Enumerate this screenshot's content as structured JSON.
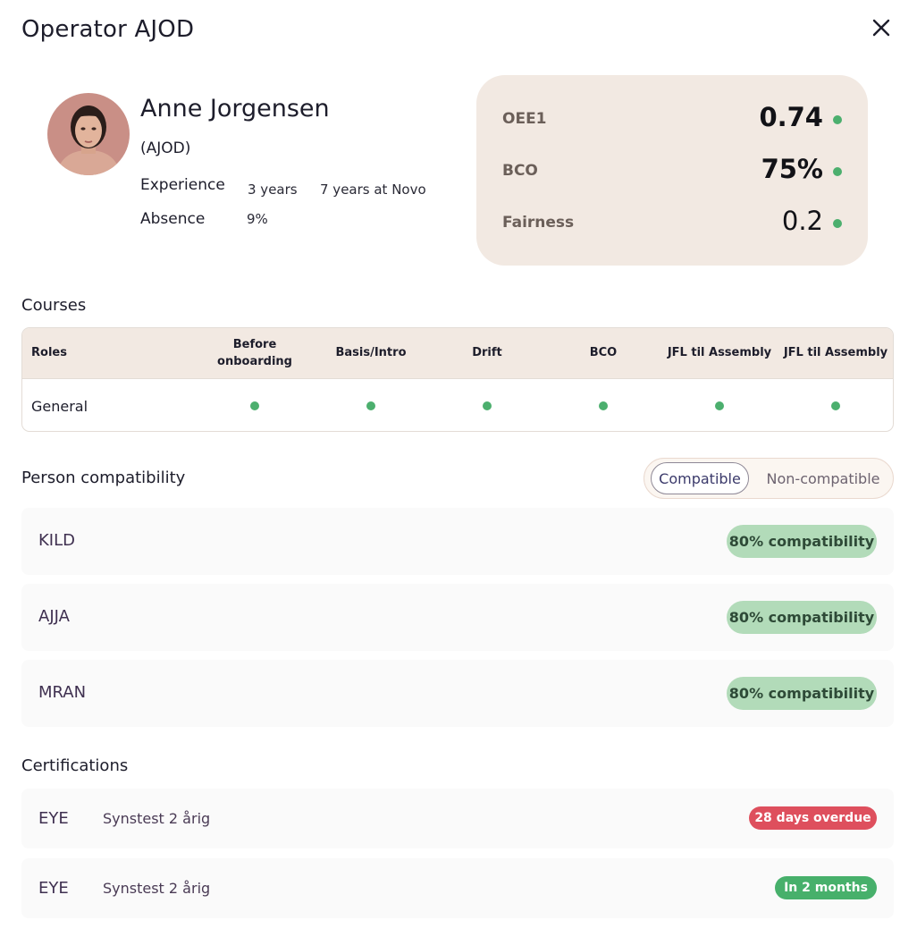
{
  "header": {
    "title": "Operator AJOD"
  },
  "profile": {
    "name": "Anne Jorgensen",
    "code": "(AJOD)",
    "experience_label": "Experience",
    "experience_value": "3 years",
    "experience_company": "7 years at Novo",
    "absence_label": "Absence",
    "absence_value": "9%"
  },
  "kpis": [
    {
      "label": "OEE1",
      "value": "0.74",
      "status_color": "#4caf6e"
    },
    {
      "label": "BCO",
      "value": "75%",
      "status_color": "#4caf6e"
    },
    {
      "label": "Fairness",
      "value": "0.2",
      "status_color": "#4caf6e"
    }
  ],
  "courses": {
    "section_title": "Courses",
    "columns": [
      "Roles",
      "Before onboarding",
      "Basis/Intro",
      "Drift",
      "BCO",
      "JFL til Assembly",
      "JFL til Assembly"
    ],
    "rows": [
      {
        "role": "General",
        "completed": [
          true,
          true,
          true,
          true,
          true,
          true
        ]
      }
    ]
  },
  "compatibility": {
    "section_title": "Person compatibility",
    "toggle": {
      "active": "Compatible",
      "inactive": "Non-compatible"
    },
    "items": [
      {
        "code": "KILD",
        "badge": "80% compatibility"
      },
      {
        "code": "AJJA",
        "badge": "80% compatibility"
      },
      {
        "code": "MRAN",
        "badge": "80% compatibility"
      }
    ]
  },
  "certifications": {
    "section_title": "Certifications",
    "items": [
      {
        "code": "EYE",
        "name": "Synstest 2 årig",
        "status": "28 days overdue",
        "status_color": "#de4f5d"
      },
      {
        "code": "EYE",
        "name": "Synstest 2 årig",
        "status": "In 2 months",
        "status_color": "#47b06b"
      }
    ]
  },
  "colors": {
    "accent_green": "#4caf6e",
    "kpi_panel": "#f2e9e2",
    "badge_compat": "#b2dbb9"
  }
}
